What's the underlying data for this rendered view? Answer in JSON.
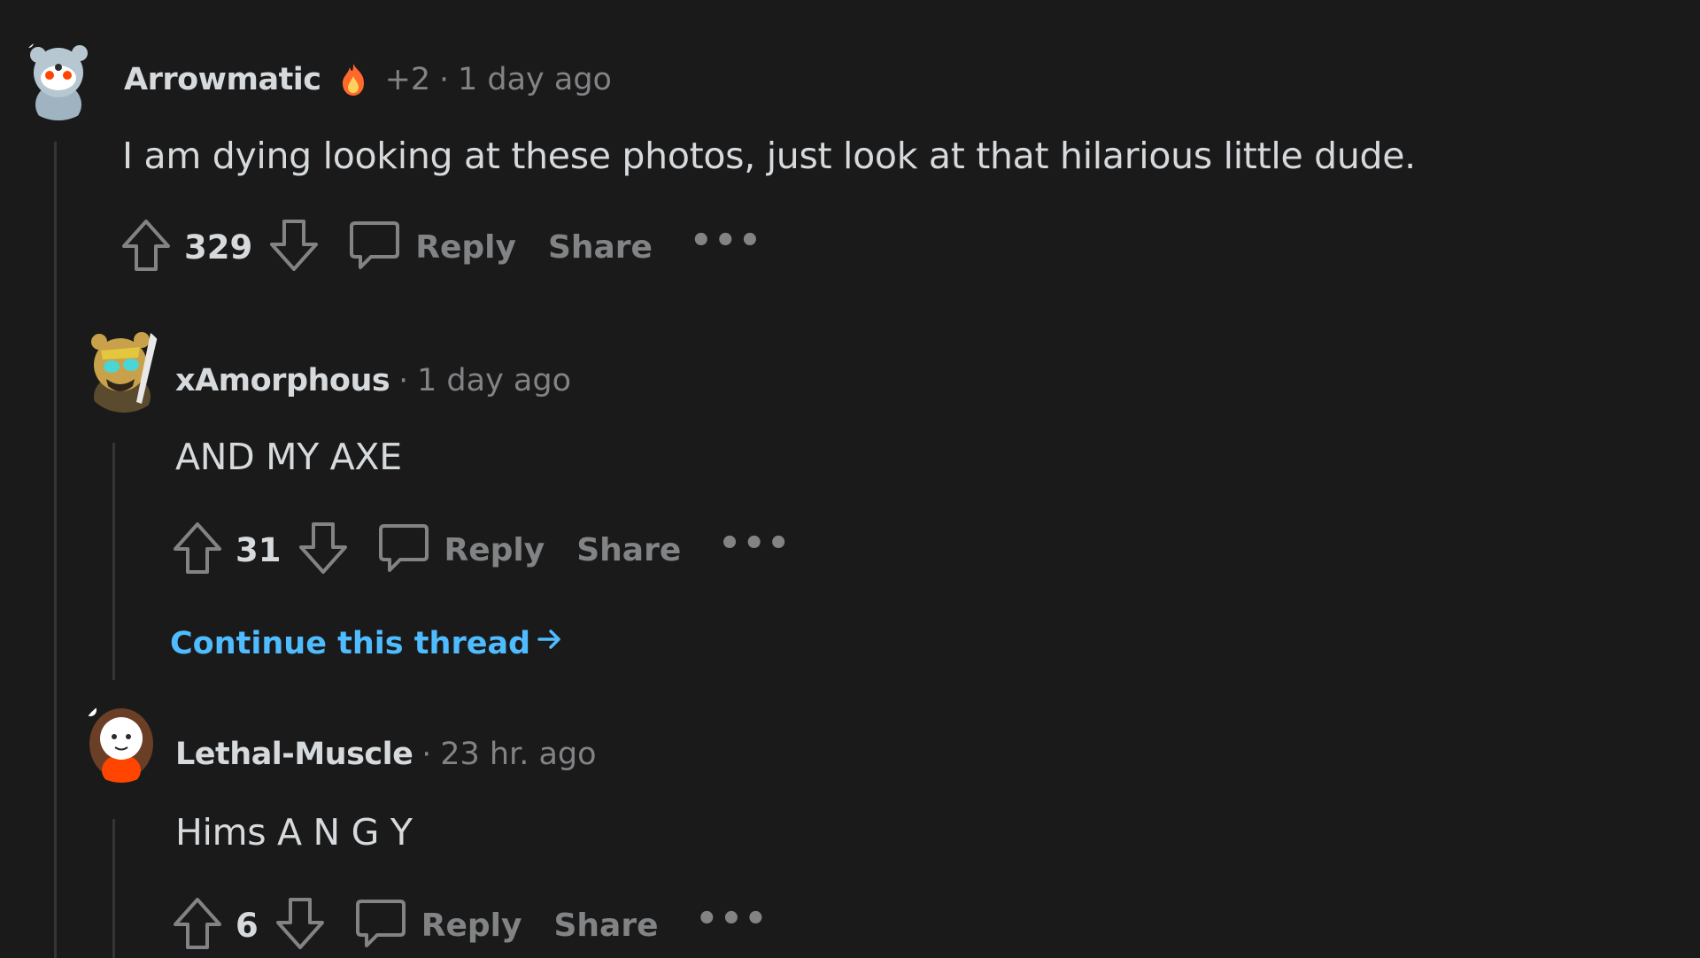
{
  "comments": [
    {
      "username": "Arrowmatic",
      "score_meta": "+2",
      "separator": "·",
      "time": "1 day ago",
      "body": "I am dying looking at these photos, just look at that hilarious little dude.",
      "votes": "329",
      "reply_label": "Reply",
      "share_label": "Share",
      "more_label": "•••"
    },
    {
      "username": "xAmorphous",
      "separator": "·",
      "time": "1 day ago",
      "body": "AND MY AXE",
      "votes": "31",
      "reply_label": "Reply",
      "share_label": "Share",
      "more_label": "•••",
      "continue_label": "Continue this thread"
    },
    {
      "username": "Lethal-Muscle",
      "separator": "·",
      "time": "23 hr. ago",
      "body": "Hims A N G Y",
      "votes": "6",
      "reply_label": "Reply",
      "share_label": "Share",
      "more_label": "•••"
    }
  ],
  "colors": {
    "background": "#1a1a1b",
    "text": "#d7dadc",
    "muted": "#818384",
    "link": "#4fbcff",
    "thread_line": "#343536"
  }
}
